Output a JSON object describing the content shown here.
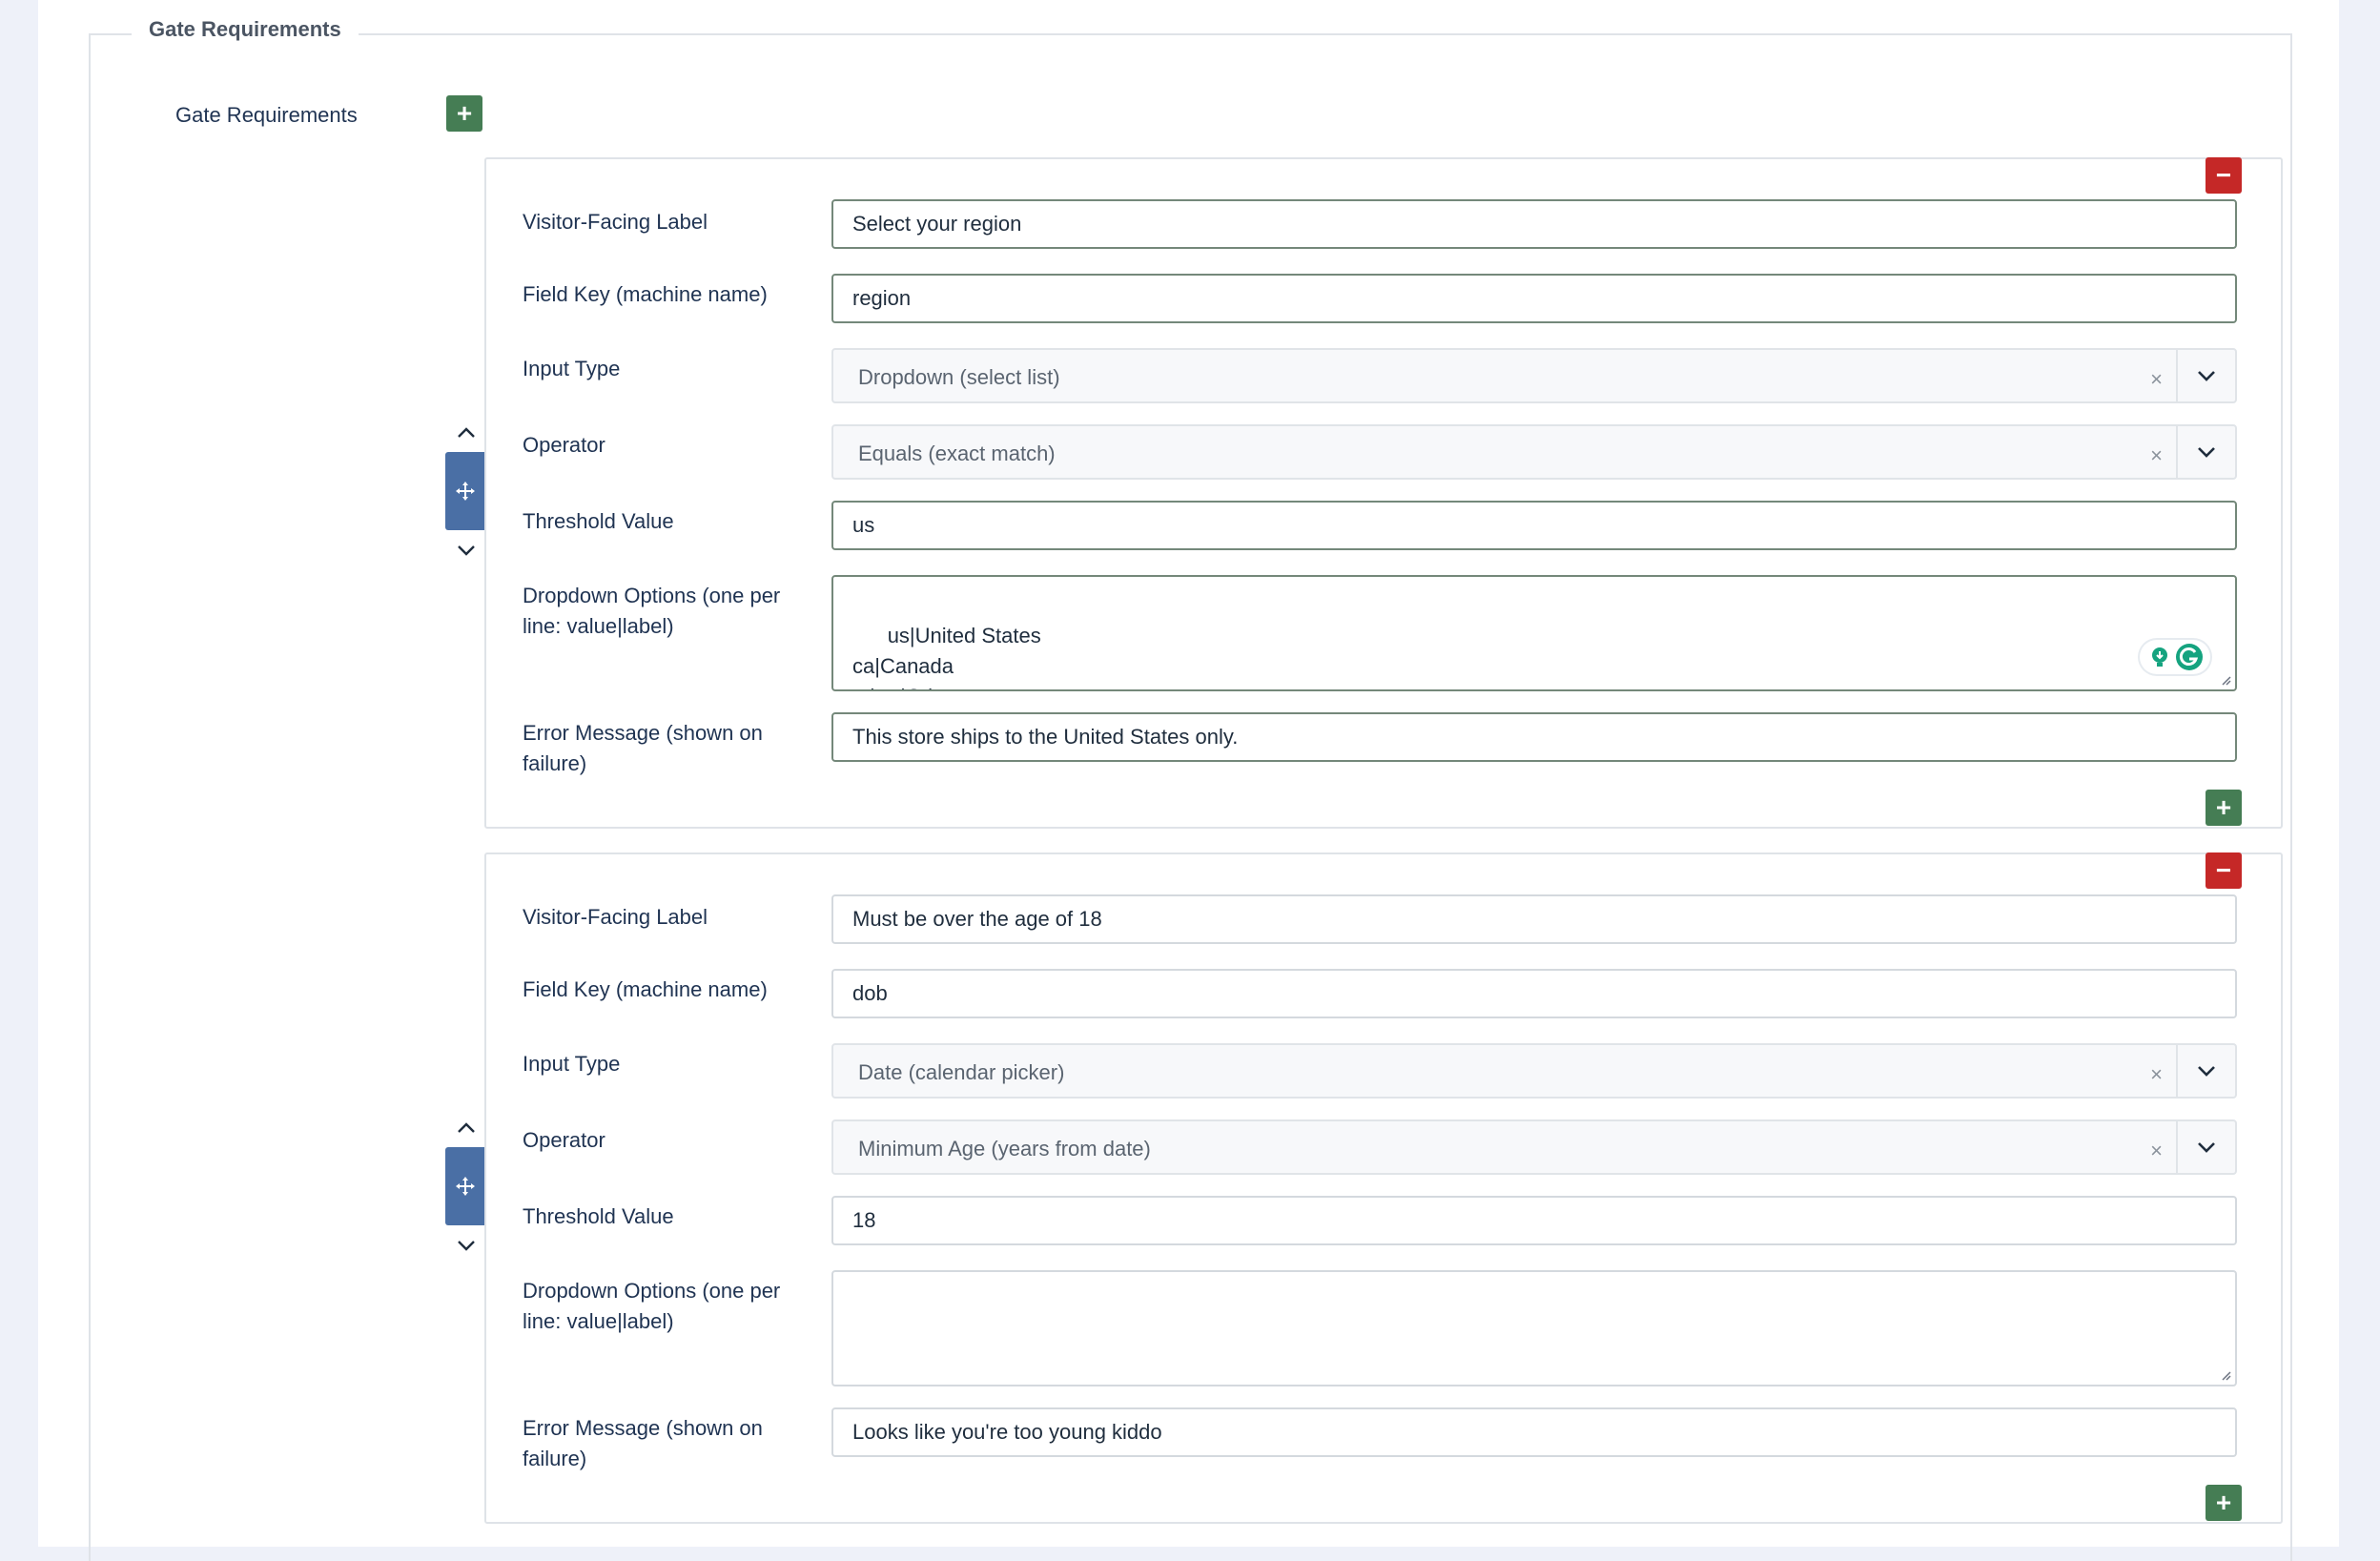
{
  "fieldset": {
    "legend": "Gate Requirements"
  },
  "group": {
    "label": "Gate Requirements"
  },
  "buttons": {
    "add": "+",
    "remove": "−"
  },
  "colors": {
    "add_button": "#457d54",
    "remove_button": "#c52827",
    "drag_handle": "#4a6fa5"
  },
  "icons": {
    "move": "move-icon",
    "up": "chevron-up-icon",
    "down": "chevron-down-icon",
    "clear": "close-icon",
    "dropdown": "chevron-down-icon"
  },
  "labels": {
    "label": "Visitor-Facing Label",
    "field_key": "Field Key (machine name)",
    "input_type": "Input Type",
    "operator": "Operator",
    "threshold": "Threshold Value",
    "options_line1": "Dropdown Options (one per",
    "options_line2": "line: value|label)",
    "error_line1": "Error Message (shown on",
    "error_line2": "failure)"
  },
  "requirements": [
    {
      "label": "Select your region",
      "field_key": "region",
      "input_type": "Dropdown (select list)",
      "operator": "Equals (exact match)",
      "threshold": "us",
      "options": "us|United States\nca|Canada\nother|Other",
      "error": "This store ships to the United States only."
    },
    {
      "label": "Must be over the age of 18",
      "field_key": "dob",
      "input_type": "Date (calendar picker)",
      "operator": "Minimum Age (years from date)",
      "threshold": "18",
      "options": "",
      "error": "Looks like you're too young kiddo"
    }
  ]
}
